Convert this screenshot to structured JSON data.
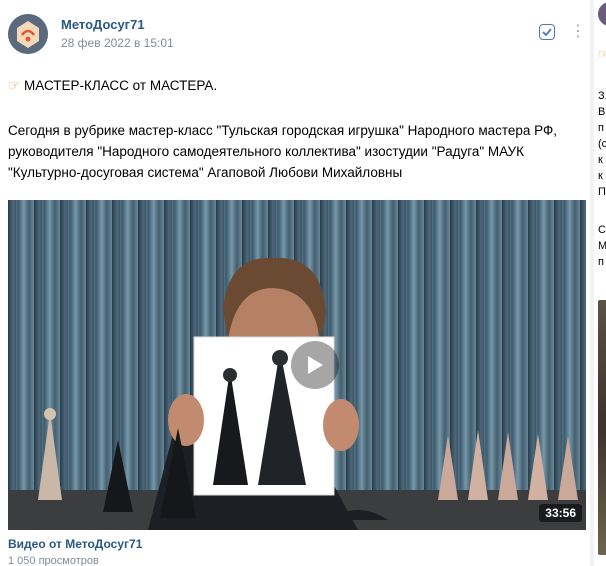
{
  "post": {
    "author": "МетоДосуг71",
    "date": "28 фев 2022 в 15:01",
    "headline": "МАСТЕР-КЛАСС от МАСТЕРА.",
    "body": "Сегодня в рубрике мастер-класс \"Тульская городская игрушка\" Народного мастера РФ, руководителя \"Народного самодеятельного коллектива\" изостудии \"Радуга\" МАУК \"Культурно-досуговая система\" Агаповой Любови Михайловны",
    "video": {
      "duration": "33:56",
      "title": "Видео от МетоДосуг71",
      "views": "1 050 просмотров"
    },
    "icons": {
      "headline": "pointing-hand-icon",
      "check": "checkbox-icon",
      "more": "more-icon",
      "play": "play-icon"
    }
  },
  "next_post": {
    "text_fragments": [
      "З,",
      "В",
      "п",
      "(с",
      "к",
      "к",
      "П",
      "С",
      "М",
      "п"
    ]
  },
  "colors": {
    "link": "#2a5885",
    "meta": "#818c99",
    "accent": "#447bba",
    "background": "#f0f2f5"
  }
}
